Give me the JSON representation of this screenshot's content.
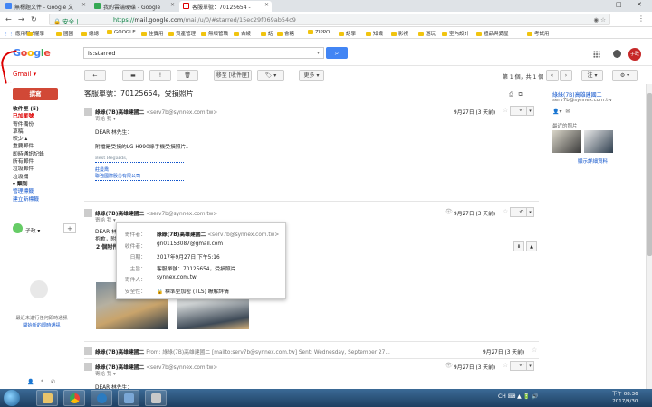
{
  "browser": {
    "tabs": [
      {
        "label": "無標題文件 - Google 文"
      },
      {
        "label": "我的雲端硬碟 - Google"
      },
      {
        "label": "客服單號：70125654 -"
      }
    ],
    "window_controls": [
      "—",
      "□",
      "✕"
    ],
    "secure_label": "安全",
    "url_scheme": "https://",
    "url_host": "mail.google.com",
    "url_path": "/mail/u/0/#starred/15ec29f069ab54c9",
    "bookmarks": [
      "應用程式",
      "權學",
      "國國",
      "總總",
      "GOOGLE",
      "住實用",
      "資產管理",
      "無壞管職",
      "古綾",
      "話",
      "會糖",
      "ZIPPO",
      "話學",
      "知識",
      "影視",
      "遊玩",
      "室內設計",
      "禮品與愛屋",
      "考試用"
    ]
  },
  "gmail": {
    "logo_letters": [
      "G",
      "o",
      "o",
      "g",
      "l",
      "e"
    ],
    "product_label": "Gmail ▾",
    "search_query": "is:starred",
    "compose_label": "撰寫",
    "toolbar": {
      "back": "←",
      "archive": "▬",
      "spam": "!",
      "delete": "🗑",
      "move_to_inbox": "移至 [收件匣]",
      "labels": "🏷 ▾",
      "more": "更多 ▾",
      "page_info": "第 1 個，共 1 個",
      "prev": "‹",
      "next": "›",
      "input_tools": "注 ▾",
      "settings": "⚙ ▾"
    },
    "nav": [
      {
        "label": "收件匣 (5)",
        "style": "bold"
      },
      {
        "label": "已加星號",
        "style": "active"
      },
      {
        "label": "寄件備份",
        "style": ""
      },
      {
        "label": "草稿",
        "style": ""
      },
      {
        "label": "較少 ▴",
        "style": ""
      },
      {
        "label": "重要郵件",
        "style": ""
      },
      {
        "label": "即時通訊記錄",
        "style": ""
      },
      {
        "label": "所有郵件",
        "style": ""
      },
      {
        "label": "垃圾郵件",
        "style": ""
      },
      {
        "label": "垃圾桶",
        "style": ""
      },
      {
        "label": "▾ 類別",
        "style": "bold"
      },
      {
        "label": "管理標籤",
        "style": "link"
      },
      {
        "label": "建立新標籤",
        "style": "link"
      }
    ],
    "chat": {
      "user": "子政 ▾",
      "add": "+",
      "empty_text": "最近未進行任何即時通訊",
      "empty_link": "開始新的即時通訊"
    },
    "thread": {
      "subject": "客服單號：70125654，受損照片",
      "messages": [
        {
          "from_name": "綠綠(7B)高雄建國二",
          "from_addr": "<serv7b@synnex.com.tw>",
          "to": "寄給 我 ▾",
          "date": "9月27日 (3 天前)",
          "body": [
            "DEAR 林先生：",
            "附檔是受損的LG H990綠手機受損照片。"
          ],
          "signature": [
            "Best Regards,",
            "莊曼喬",
            "聯強國際股份有限公司"
          ]
        },
        {
          "from_name": "綠綠(7B)高雄建國二",
          "from_addr": "<serv7b@synnex.com.tw>",
          "to": "寄給 我 ▾",
          "date": "9月27日 (3 天前)",
          "body": [
            "DEAR 林",
            "抱歉，附"
          ]
        }
      ],
      "details_popup": [
        {
          "label": "寄件者：",
          "value_bold": "綠綠(7B)高雄建國二",
          "value_muted": "<serv7b@synnex.com.tw>"
        },
        {
          "label": "收件者：",
          "value_bold": "",
          "value_muted": "gn01153087@gmail.com"
        },
        {
          "label": "日期：",
          "value_bold": "",
          "value_muted": "2017年9月27日 下午5:16"
        },
        {
          "label": "主旨：",
          "value_bold": "",
          "value_muted": "客服單號：70125654，受損照片"
        },
        {
          "label": "寄件人：",
          "value_bold": "",
          "value_muted": "synnex.com.tw"
        },
        {
          "label": "安全性：",
          "value_bold": "",
          "value_muted": "🔒 標準型加密 (TLS) 瞭解詳情"
        }
      ],
      "attachments_header": "2 個附件",
      "collapsed": {
        "from": "綠綠(7B)高雄建國二",
        "snippet": "From: 綠綠(7B)高雄建國二 [mailto:serv7b@synnex.com.tw] Sent: Wednesday, September 27...",
        "date": "9月27日 (3 天前)"
      },
      "fourth": {
        "from_name": "綠綠(7B)高雄建國二",
        "from_addr": "<serv7b@synnex.com.tw>",
        "to": "寄給 我 ▾",
        "date": "9月27日 (3 天前)",
        "body": "DEAR 林先生："
      }
    },
    "right_panel": {
      "name": "綠綠(7B)高雄建國二",
      "email": "serv7b@synnex.com.tw",
      "recent_photos": "最近的照片",
      "link": "顯示詳細資料"
    }
  },
  "taskbar": {
    "tray": "CH ⌨ ▲ 🔋 🔊",
    "time": "下午 08:36",
    "date": "2017/9/30"
  },
  "colors": {
    "compose": "#d14836",
    "active_nav": "#dd0000",
    "link": "#1155cc",
    "search_button": "#4285f4"
  }
}
